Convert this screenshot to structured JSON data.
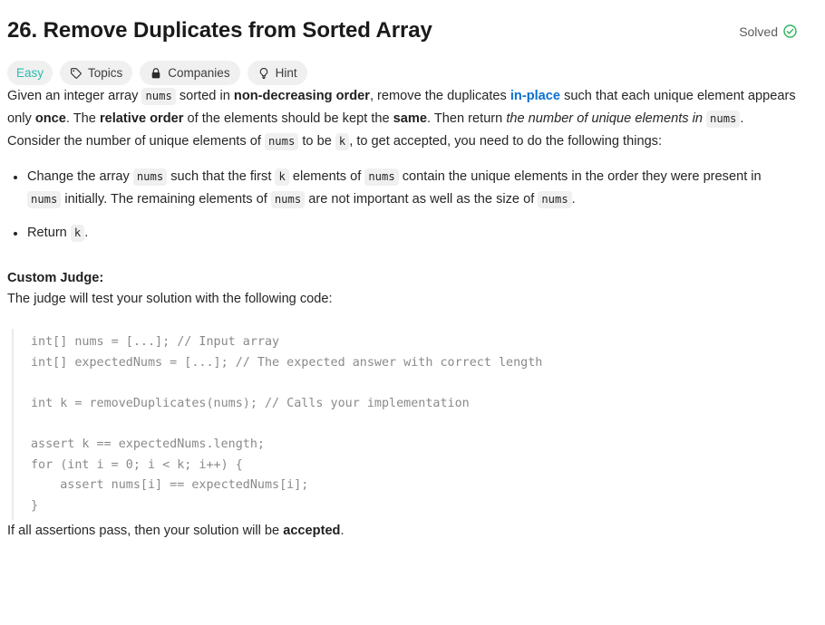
{
  "header": {
    "title": "26. Remove Duplicates from Sorted Array",
    "status_label": "Solved",
    "status_icon": "check-circle-icon",
    "status_color": "#2db55d"
  },
  "badges": [
    {
      "label": "Easy",
      "icon": null,
      "kind": "difficulty",
      "color": "#2cbcae"
    },
    {
      "label": "Topics",
      "icon": "tag-icon",
      "kind": "action"
    },
    {
      "label": "Companies",
      "icon": "lock-icon",
      "kind": "action"
    },
    {
      "label": "Hint",
      "icon": "lightbulb-icon",
      "kind": "action"
    }
  ],
  "description": {
    "intro": {
      "s1": "Given an integer array ",
      "code1": "nums",
      "s2": " sorted in ",
      "b1": "non-decreasing order",
      "s3": ", remove the duplicates ",
      "link1": "in-place",
      "s4": " such that each unique element appears only ",
      "b2": "once",
      "s5": ". The ",
      "b3": "relative order",
      "s6": " of the elements should be kept the ",
      "b4": "same",
      "s7": ". Then return ",
      "i1": "the number of unique elements in",
      "code2": "nums",
      "s8": "."
    },
    "consider": {
      "s1": "Consider the number of unique elements of ",
      "code1": "nums",
      "s2": " to be ",
      "code2": "k",
      "s3": ", to get accepted, you need to do the following things:"
    },
    "bullets": [
      {
        "s1": "Change the array ",
        "code1": "nums",
        "s2": " such that the first ",
        "code2": "k",
        "s3": " elements of ",
        "code3": "nums",
        "s4": " contain the unique elements in the order they were present in ",
        "code4": "nums",
        "s5": " initially. The remaining elements of ",
        "code5": "nums",
        "s6": " are not important as well as the size of ",
        "code6": "nums",
        "s7": "."
      },
      {
        "s1": "Return ",
        "code1": "k",
        "s2": "."
      }
    ],
    "custom_judge_heading": "Custom Judge:",
    "judge_intro": "The judge will test your solution with the following code:",
    "code": "int[] nums = [...]; // Input array\nint[] expectedNums = [...]; // The expected answer with correct length\n\nint k = removeDuplicates(nums); // Calls your implementation\n\nassert k == expectedNums.length;\nfor (int i = 0; i < k; i++) {\n    assert nums[i] == expectedNums[i];\n}",
    "accepted": {
      "s1": "If all assertions pass, then your solution will be ",
      "b1": "accepted",
      "s2": "."
    }
  }
}
